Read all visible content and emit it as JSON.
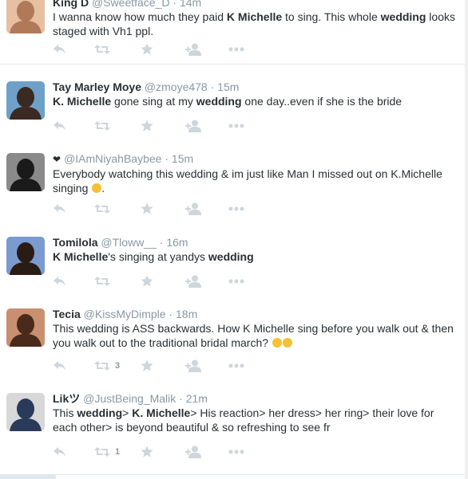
{
  "tweets": [
    {
      "name": "King D",
      "handle": "@Sweetface_D",
      "time": "14m",
      "text": [
        {
          "t": "I wanna know how much they paid ",
          "b": false
        },
        {
          "t": "K Michelle",
          "b": true
        },
        {
          "t": " to sing. This whole ",
          "b": false
        },
        {
          "t": "wedding",
          "b": true
        },
        {
          "t": " looks staged with Vh1 ppl.",
          "b": false
        }
      ],
      "retweet_count": "",
      "avatar_colors": [
        "#b07a5a",
        "#e6c0a0"
      ]
    },
    {
      "name": "Tay Marley Moye",
      "handle": "@zmoye478",
      "time": "15m",
      "text": [
        {
          "t": "K. Michelle",
          "b": true
        },
        {
          "t": " gone sing at my ",
          "b": false
        },
        {
          "t": "wedding",
          "b": true
        },
        {
          "t": " one day..even if she is the bride",
          "b": false
        }
      ],
      "retweet_count": "",
      "avatar_colors": [
        "#3a2a22",
        "#6fa0c8"
      ]
    },
    {
      "name": "",
      "prefix_icon": "❤",
      "handle": "@IAmNiyahBaybee",
      "time": "15m",
      "text": [
        {
          "t": "Everybody watching this wedding & im just like Man I missed out on K.Michelle singing ",
          "b": false
        },
        {
          "t": ".",
          "b": false
        }
      ],
      "emoji_after_index": 0,
      "retweet_count": "",
      "avatar_colors": [
        "#1a1a1a",
        "#8a8a8a"
      ]
    },
    {
      "name": "Tomilola",
      "handle": "@Tloww__",
      "time": "16m",
      "text": [
        {
          "t": "K Michelle",
          "b": true
        },
        {
          "t": "'s singing at yandys ",
          "b": false
        },
        {
          "t": "wedding",
          "b": true
        }
      ],
      "retweet_count": "",
      "avatar_colors": [
        "#2a1c14",
        "#7a9ad0"
      ]
    },
    {
      "name": "Tecia",
      "handle": "@KissMyDimple",
      "time": "18m",
      "text": [
        {
          "t": "This wedding is ASS backwards. How K Michelle sing before you walk out & then you walk out to the traditional bridal march? ",
          "b": false
        }
      ],
      "emoji_trailing": 2,
      "retweet_count": "3",
      "avatar_colors": [
        "#4a2a1a",
        "#c89070"
      ]
    },
    {
      "name": "Likツ",
      "handle": "@JustBeing_Malik",
      "time": "21m",
      "text": [
        {
          "t": "This ",
          "b": false
        },
        {
          "t": "wedding",
          "b": true
        },
        {
          "t": "> ",
          "b": false
        },
        {
          "t": "K. Michelle",
          "b": true
        },
        {
          "t": "> His reaction> her dress> her ring> their love for each other> is beyond beautiful & so refreshing to see fr",
          "b": false
        }
      ],
      "retweet_count": "1",
      "avatar_colors": [
        "#2a3a5a",
        "#d8d8d8"
      ]
    }
  ],
  "icons": {
    "reply": "reply-icon",
    "retweet": "retweet-icon",
    "favorite": "star-icon",
    "follow": "follow-icon",
    "more": "more-icon"
  },
  "colors": {
    "action_gray": "#ccd6dd",
    "text": "#292f33",
    "muted": "#8899a6",
    "divider": "#e1e8ed"
  }
}
